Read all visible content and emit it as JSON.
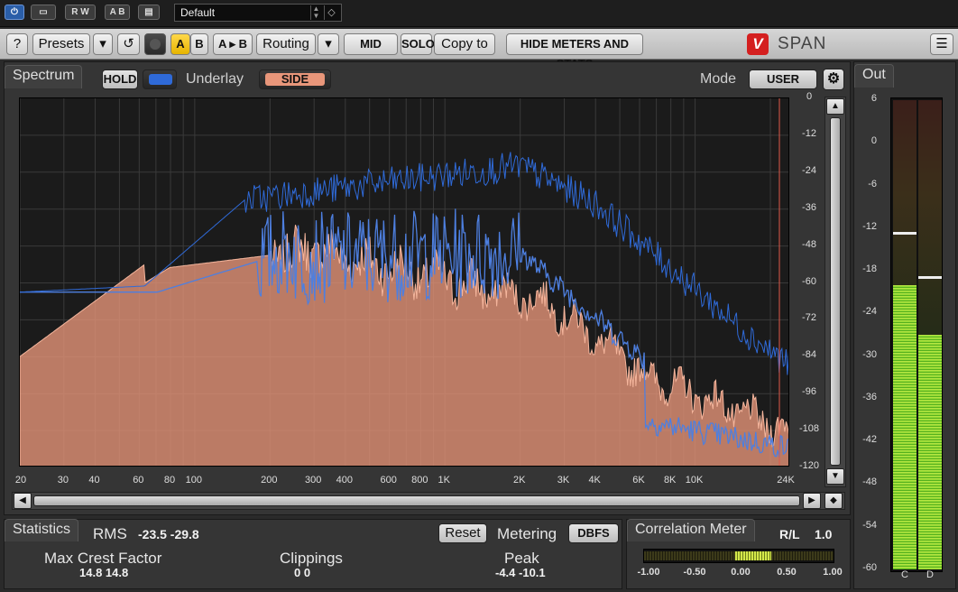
{
  "host": {
    "power_label": "⏻",
    "compare_label": "▭",
    "rw_label": "R W",
    "ab_label": "A B",
    "menu_label": "▤",
    "preset_name": "Default"
  },
  "toolbar": {
    "help": "?",
    "presets": "Presets",
    "presets_arrow": "▾",
    "undo": "↺",
    "a": "A",
    "b": "B",
    "a_to_b": "A ▸ B",
    "routing": "Routing",
    "routing_arrow": "▾",
    "mid": "MID",
    "solo": "SOLO",
    "copy_to": "Copy to",
    "hide_meters": "HIDE METERS AND STATS",
    "brand": "SPAN",
    "menu": "☰"
  },
  "spectrum": {
    "tab": "Spectrum",
    "hold": "HOLD",
    "underlay_label": "Underlay",
    "side": "SIDE",
    "mode_label": "Mode",
    "mode_value": "USER",
    "y_ticks": [
      "0",
      "-12",
      "-24",
      "-36",
      "-48",
      "-60",
      "-72",
      "-84",
      "-96",
      "-108",
      "-120"
    ],
    "x_ticks": [
      {
        "label": "20",
        "f": 20
      },
      {
        "label": "30",
        "f": 30
      },
      {
        "label": "40",
        "f": 40
      },
      {
        "label": "60",
        "f": 60
      },
      {
        "label": "80",
        "f": 80
      },
      {
        "label": "100",
        "f": 100
      },
      {
        "label": "200",
        "f": 200
      },
      {
        "label": "300",
        "f": 300
      },
      {
        "label": "400",
        "f": 400
      },
      {
        "label": "600",
        "f": 600
      },
      {
        "label": "800",
        "f": 800
      },
      {
        "label": "1K",
        "f": 1000
      },
      {
        "label": "2K",
        "f": 2000
      },
      {
        "label": "3K",
        "f": 3000
      },
      {
        "label": "4K",
        "f": 4000
      },
      {
        "label": "6K",
        "f": 6000
      },
      {
        "label": "8K",
        "f": 8000
      },
      {
        "label": "10K",
        "f": 10000
      },
      {
        "label": "24K",
        "f": 24000
      }
    ],
    "colors": {
      "side": "#e8967a",
      "main": "#4d7fe0",
      "hold": "#2f6ad8"
    }
  },
  "output": {
    "tab": "Out",
    "ticks": [
      "6",
      "0",
      "-6",
      "-12",
      "-18",
      "-24",
      "-30",
      "-36",
      "-42",
      "-48",
      "-54",
      "-60"
    ],
    "channels": [
      "C",
      "D"
    ],
    "levels_db": [
      -20,
      -27
    ],
    "peaks_db": [
      -12.5,
      -18.8
    ]
  },
  "statistics": {
    "tab": "Statistics",
    "rms_label": "RMS",
    "rms_values": "-23.5  -29.8",
    "reset": "Reset",
    "metering_label": "Metering",
    "metering_value": "DBFS",
    "crest_label": "Max Crest Factor",
    "crest_values": "14.8   14.8",
    "clip_label": "Clippings",
    "clip_values": "0        0",
    "peak_label": "Peak",
    "peak_values": "-4.4   -10.1"
  },
  "correlation": {
    "tab": "Correlation Meter",
    "rl_label": "R/L",
    "rl_value": "1.0",
    "scale": [
      "-1.00",
      "-0.50",
      "0.00",
      "0.50",
      "1.00"
    ],
    "value": 0.3
  }
}
